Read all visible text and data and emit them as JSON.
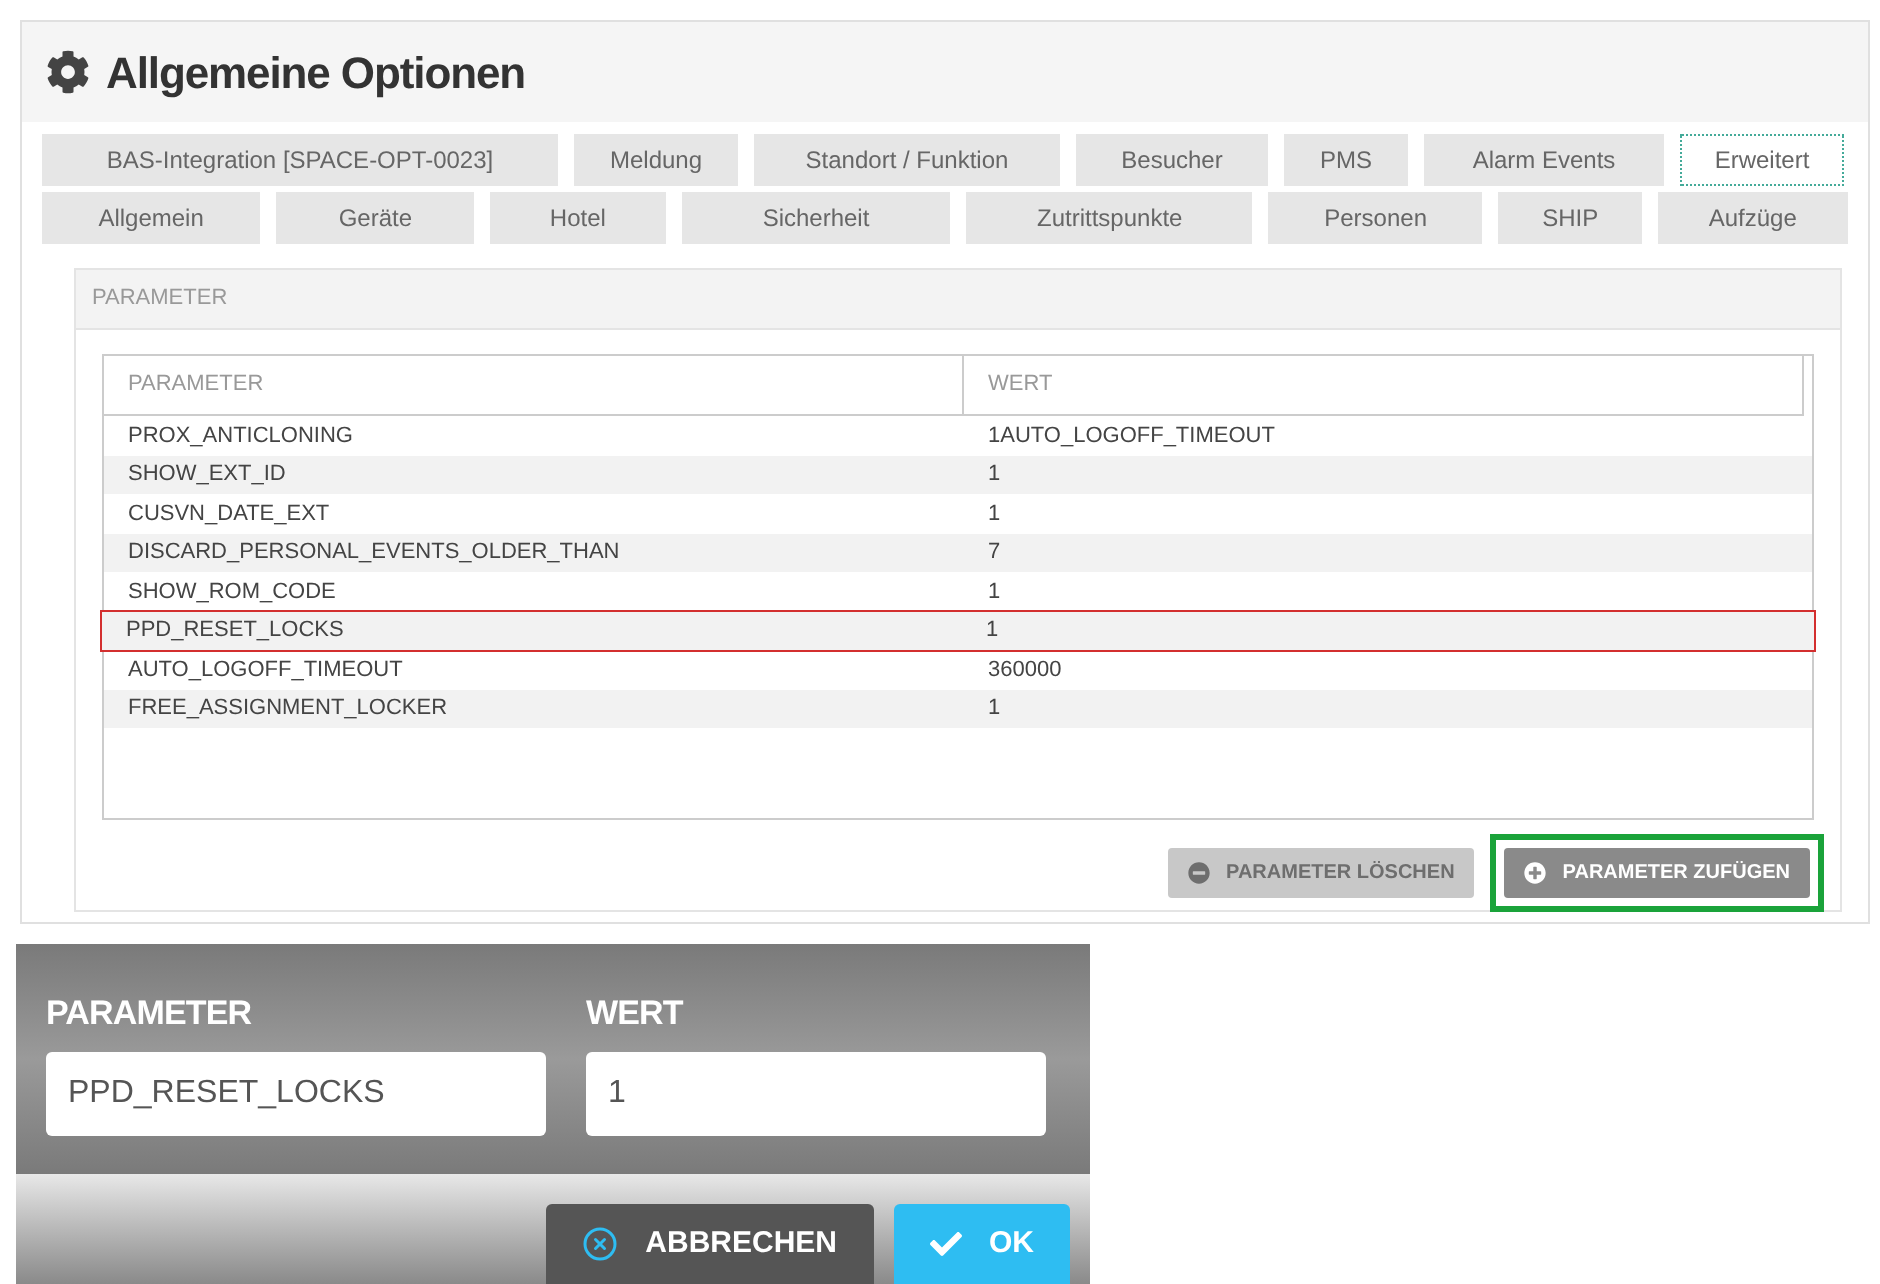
{
  "window": {
    "title": "Allgemeine Optionen"
  },
  "tab_rows": [
    [
      {
        "label": "BAS-Integration [SPACE-OPT-0023]",
        "selected": false
      },
      {
        "label": "Meldung",
        "selected": false
      },
      {
        "label": "Standort / Funktion",
        "selected": false
      },
      {
        "label": "Besucher",
        "selected": false
      },
      {
        "label": "PMS",
        "selected": false
      },
      {
        "label": "Alarm Events",
        "selected": false
      },
      {
        "label": "Erweitert",
        "selected": true
      }
    ],
    [
      {
        "label": "Allgemein",
        "selected": false
      },
      {
        "label": "Geräte",
        "selected": false
      },
      {
        "label": "Hotel",
        "selected": false
      },
      {
        "label": "Sicherheit",
        "selected": false
      },
      {
        "label": "Zutrittspunkte",
        "selected": false
      },
      {
        "label": "Personen",
        "selected": false
      },
      {
        "label": "SHIP",
        "selected": false
      },
      {
        "label": "Aufzüge",
        "selected": false
      }
    ]
  ],
  "panel": {
    "title": "PARAMETER"
  },
  "table": {
    "columns": [
      "PARAMETER",
      "WERT"
    ],
    "rows": [
      {
        "cells": [
          "PROX_ANTICLONING",
          "1AUTO_LOGOFF_TIMEOUT"
        ],
        "highlighted": false
      },
      {
        "cells": [
          "SHOW_EXT_ID",
          "1"
        ],
        "highlighted": false
      },
      {
        "cells": [
          "CUSVN_DATE_EXT",
          "1"
        ],
        "highlighted": false
      },
      {
        "cells": [
          "DISCARD_PERSONAL_EVENTS_OLDER_THAN",
          "7"
        ],
        "highlighted": false
      },
      {
        "cells": [
          "SHOW_ROM_CODE",
          "1"
        ],
        "highlighted": false
      },
      {
        "cells": [
          "PPD_RESET_LOCKS",
          "1"
        ],
        "highlighted": true
      },
      {
        "cells": [
          "AUTO_LOGOFF_TIMEOUT",
          "360000"
        ],
        "highlighted": false
      },
      {
        "cells": [
          "FREE_ASSIGNMENT_LOCKER",
          "1"
        ],
        "highlighted": false
      }
    ]
  },
  "buttons": [
    {
      "label": "PARAMETER LÖSCHEN",
      "kind": "remove",
      "disabled": true,
      "highlighted": false
    },
    {
      "label": "PARAMETER ZUFÜGEN",
      "kind": "add",
      "disabled": false,
      "highlighted": true
    }
  ],
  "dialog": {
    "fields": [
      {
        "label": "PARAMETER",
        "value": "PPD_RESET_LOCKS"
      },
      {
        "label": "WERT",
        "value": "1"
      }
    ],
    "buttons": [
      {
        "label": "ABBRECHEN",
        "kind": "cancel"
      },
      {
        "label": "OK",
        "kind": "ok"
      }
    ]
  }
}
